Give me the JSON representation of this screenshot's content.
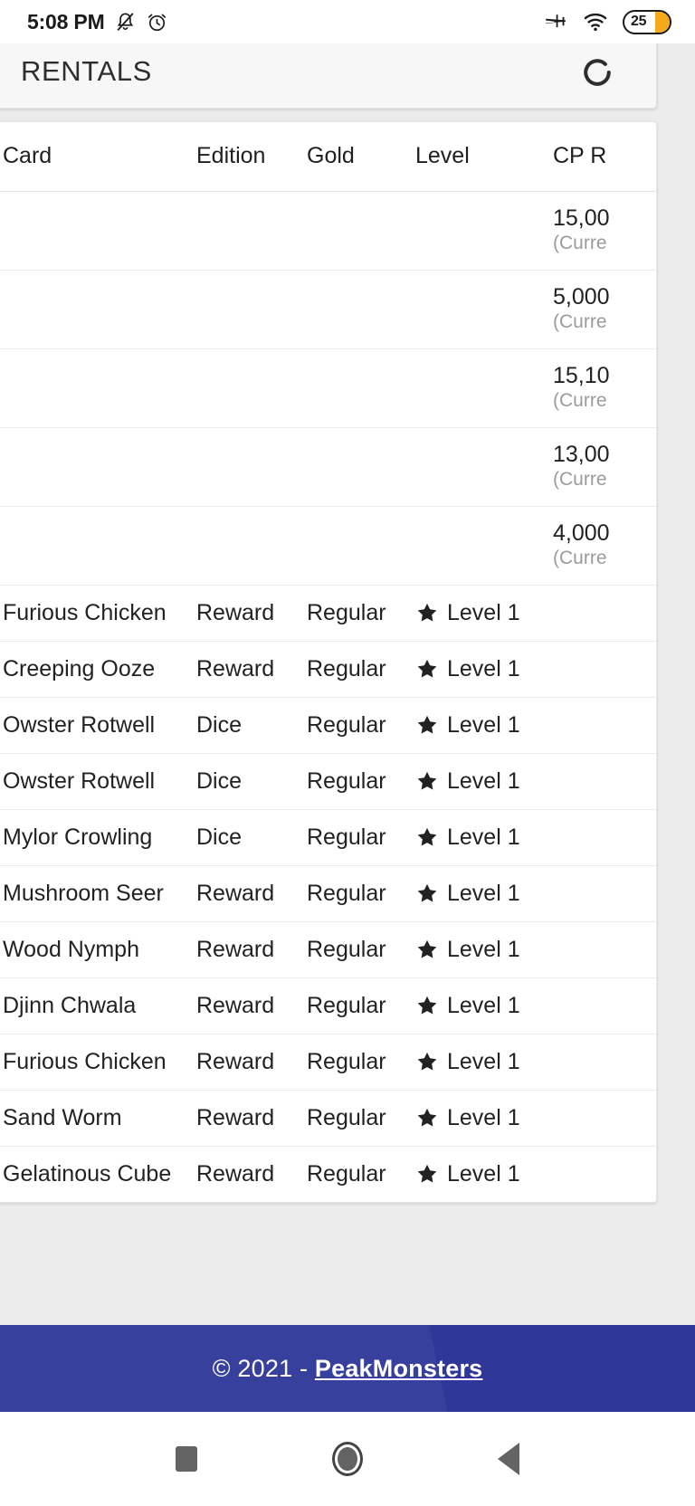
{
  "status_bar": {
    "time": "5:08 PM",
    "icons": [
      "notifications-silenced-icon",
      "alarm-icon",
      "airplane-mode-icon",
      "wifi-icon"
    ],
    "battery_level": "25"
  },
  "header": {
    "title": "RENTALS",
    "accent_color": "#e8175d",
    "refresh_label": "refresh-icon"
  },
  "table": {
    "columns": [
      "Card",
      "Edition",
      "Gold",
      "Level",
      "CP R"
    ],
    "top_rows": [
      {
        "cp": "15,00",
        "cp_note": "(Curre"
      },
      {
        "cp": "5,000",
        "cp_note": "(Curre"
      },
      {
        "cp": "15,10",
        "cp_note": "(Curre"
      },
      {
        "cp": "13,00",
        "cp_note": "(Curre"
      },
      {
        "cp": "4,000",
        "cp_note": "(Curre"
      }
    ],
    "rows": [
      {
        "card": "Furious Chicken",
        "edition": "Reward",
        "gold": "Regular",
        "level": "Level 1"
      },
      {
        "card": "Creeping Ooze",
        "edition": "Reward",
        "gold": "Regular",
        "level": "Level 1"
      },
      {
        "card": "Owster Rotwell",
        "edition": "Dice",
        "gold": "Regular",
        "level": "Level 1"
      },
      {
        "card": "Owster Rotwell",
        "edition": "Dice",
        "gold": "Regular",
        "level": "Level 1"
      },
      {
        "card": "Mylor Crowling",
        "edition": "Dice",
        "gold": "Regular",
        "level": "Level 1"
      },
      {
        "card": "Mushroom Seer",
        "edition": "Reward",
        "gold": "Regular",
        "level": "Level 1"
      },
      {
        "card": "Wood Nymph",
        "edition": "Reward",
        "gold": "Regular",
        "level": "Level 1"
      },
      {
        "card": "Djinn Chwala",
        "edition": "Reward",
        "gold": "Regular",
        "level": "Level 1"
      },
      {
        "card": "Furious Chicken",
        "edition": "Reward",
        "gold": "Regular",
        "level": "Level 1"
      },
      {
        "card": "Sand Worm",
        "edition": "Reward",
        "gold": "Regular",
        "level": "Level 1"
      },
      {
        "card": "Gelatinous Cube",
        "edition": "Reward",
        "gold": "Regular",
        "level": "Level 1"
      }
    ]
  },
  "footer": {
    "copyright": "© 2021 - ",
    "link": "PeakMonsters",
    "background_color": "#2f3899"
  },
  "nav_bar": {
    "recents": "recents-square-icon",
    "home": "home-circle-icon",
    "back": "back-triangle-icon"
  }
}
